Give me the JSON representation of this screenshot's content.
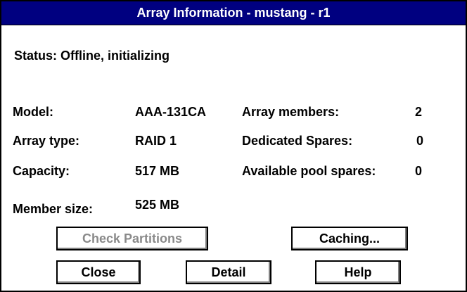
{
  "window": {
    "title": "Array Information - mustang - r1"
  },
  "status": {
    "text": "Status:  Offline, initializing"
  },
  "fields": {
    "model_label": "Model:",
    "model_value": "AAA-131CA",
    "array_type_label": "Array type:",
    "array_type_value": "RAID 1",
    "capacity_label": "Capacity:",
    "capacity_value": "517 MB",
    "member_size_label": "Member size:",
    "member_size_value": "525 MB",
    "array_members_label": "Array members:",
    "array_members_value": "2",
    "dedicated_spares_label": "Dedicated Spares:",
    "dedicated_spares_value": "0",
    "available_pool_spares_label": "Available pool spares:",
    "available_pool_spares_value": "0"
  },
  "buttons": {
    "check_partitions": "Check Partitions",
    "caching": "Caching...",
    "close": "Close",
    "detail": "Detail",
    "help": "Help"
  },
  "colors": {
    "titlebar": "#000080",
    "title_text": "#ffffff",
    "disabled_text": "#8a8a8a"
  }
}
